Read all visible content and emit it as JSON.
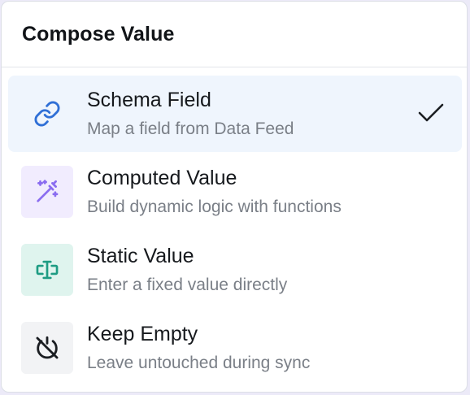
{
  "header": {
    "title": "Compose Value"
  },
  "options": [
    {
      "title": "Schema Field",
      "description": "Map a field from Data Feed",
      "icon": "link-icon",
      "selected": true,
      "icon_color": "#2f6fd6",
      "icon_bg": "transparent"
    },
    {
      "title": "Computed Value",
      "description": "Build dynamic logic with functions",
      "icon": "magic-wand-icon",
      "selected": false,
      "icon_color": "#8a6cf0",
      "icon_bg": "#f1ecfe"
    },
    {
      "title": "Static Value",
      "description": "Enter a fixed value directly",
      "icon": "text-cursor-icon",
      "selected": false,
      "icon_color": "#1e9c83",
      "icon_bg": "#dff4ee"
    },
    {
      "title": "Keep Empty",
      "description": "Leave untouched during sync",
      "icon": "power-off-icon",
      "selected": false,
      "icon_color": "#1b1e22",
      "icon_bg": "#f2f3f5"
    }
  ],
  "colors": {
    "selected_bg": "#eff5fd",
    "check": "#1b1e22"
  }
}
